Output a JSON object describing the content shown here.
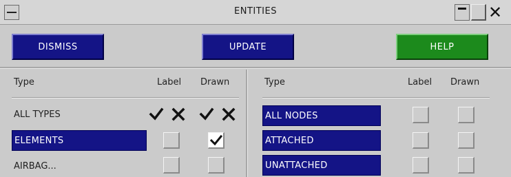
{
  "window": {
    "title": "ENTITIES",
    "controls": [
      "minimize-icon",
      "maximize-icon",
      "close-icon"
    ]
  },
  "toolbar": {
    "dismiss_label": "DISMISS",
    "update_label": "UPDATE",
    "help_label": "HELP"
  },
  "colors": {
    "selected_bg": "#141486",
    "button_blue": "#141486",
    "button_green": "#1c8a1c",
    "panel_bg": "#cbcbcb"
  },
  "left_panel": {
    "headers": {
      "type": "Type",
      "label": "Label",
      "drawn": "Drawn"
    },
    "all_row": {
      "label": "ALL TYPES",
      "label_all_icons": [
        "check-icon",
        "cross-icon"
      ],
      "drawn_all_icons": [
        "check-icon",
        "cross-icon"
      ]
    },
    "rows": [
      {
        "label": "ELEMENTS",
        "selected": true,
        "label_checked": false,
        "drawn_checked": true
      },
      {
        "label": "AIRBAG...",
        "selected": false,
        "label_checked": false,
        "drawn_checked": false
      }
    ]
  },
  "right_panel": {
    "headers": {
      "type": "Type",
      "label": "Label",
      "drawn": "Drawn"
    },
    "rows": [
      {
        "label": "ALL NODES",
        "selected": true,
        "label_checked": false,
        "drawn_checked": false
      },
      {
        "label": "ATTACHED",
        "selected": true,
        "label_checked": false,
        "drawn_checked": false
      },
      {
        "label": "UNATTACHED",
        "selected": true,
        "label_checked": false,
        "drawn_checked": false
      }
    ]
  }
}
